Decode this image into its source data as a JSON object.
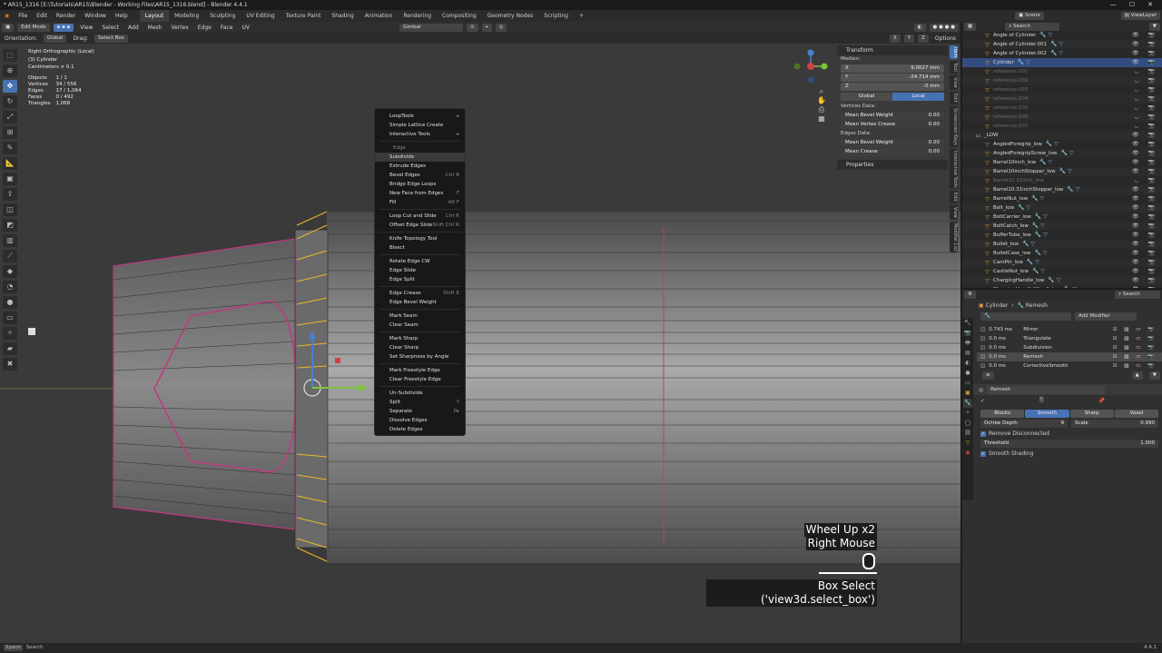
{
  "titlebar": {
    "title": "* AR15_1316 [E:\\Tutorials\\AR15\\Blender - Working Files\\AR15_1316.blend] - Blender 4.4.1"
  },
  "menus": [
    "File",
    "Edit",
    "Render",
    "Window",
    "Help"
  ],
  "workspaces": [
    "Layout",
    "Modeling",
    "Sculpting",
    "UV Editing",
    "Texture Paint",
    "Shading",
    "Animation",
    "Rendering",
    "Compositing",
    "Geometry Nodes",
    "Scripting"
  ],
  "top_right": {
    "scene": "Scene",
    "view_layer": "ViewLayer"
  },
  "viewport_header": {
    "mode": "Edit Mode",
    "menus": [
      "View",
      "Select",
      "Add",
      "Mesh",
      "Vertex",
      "Edge",
      "Face",
      "UV"
    ],
    "transform_orientation": "Gimbal",
    "orientation_label": "Orientation:",
    "orientation_value": "Global",
    "drag_label": "Drag:",
    "drag_value": "Select Box",
    "axes": [
      "X",
      "Y",
      "Z"
    ],
    "options": "Options"
  },
  "stats": {
    "view": "Right Orthographic (Local)",
    "object": "(3) Cylinder",
    "units": "Centimeters × 0.1",
    "rows": [
      {
        "label": "Objects",
        "value": "1 / 1"
      },
      {
        "label": "Vertices",
        "value": "34 / 556"
      },
      {
        "label": "Edges",
        "value": "17 / 1,064"
      },
      {
        "label": "Faces",
        "value": "0 / 492"
      },
      {
        "label": "Triangles",
        "value": "1,068"
      }
    ]
  },
  "context_menu": {
    "items": [
      {
        "label": "LoopTools",
        "shortcut": "▸"
      },
      {
        "label": "Simple Lattice Create",
        "shortcut": ""
      },
      {
        "label": "Interactive Tools",
        "shortcut": "▸"
      },
      {
        "sep": true
      },
      {
        "label": "Edge",
        "shortcut": "",
        "header": true
      },
      {
        "label": "Subdivide",
        "shortcut": "",
        "hl": true
      },
      {
        "label": "Extrude Edges",
        "shortcut": ""
      },
      {
        "label": "Bevel Edges",
        "shortcut": "Ctrl B"
      },
      {
        "label": "Bridge Edge Loops",
        "shortcut": ""
      },
      {
        "label": "New Face from Edges",
        "shortcut": "F"
      },
      {
        "label": "Fill",
        "shortcut": "Alt F"
      },
      {
        "sep": true
      },
      {
        "label": "Loop Cut and Slide",
        "shortcut": "Ctrl R"
      },
      {
        "label": "Offset Edge Slide",
        "shortcut": "Shift Ctrl R"
      },
      {
        "sep": true
      },
      {
        "label": "Knife Topology Tool",
        "shortcut": ""
      },
      {
        "label": "Bisect",
        "shortcut": ""
      },
      {
        "sep": true
      },
      {
        "label": "Rotate Edge CW",
        "shortcut": ""
      },
      {
        "label": "Edge Slide",
        "shortcut": ""
      },
      {
        "label": "Edge Split",
        "shortcut": ""
      },
      {
        "sep": true
      },
      {
        "label": "Edge Crease",
        "shortcut": "Shift E"
      },
      {
        "label": "Edge Bevel Weight",
        "shortcut": ""
      },
      {
        "sep": true
      },
      {
        "label": "Mark Seam",
        "shortcut": ""
      },
      {
        "label": "Clear Seam",
        "shortcut": ""
      },
      {
        "sep": true
      },
      {
        "label": "Mark Sharp",
        "shortcut": ""
      },
      {
        "label": "Clear Sharp",
        "shortcut": ""
      },
      {
        "label": "Set Sharpness by Angle",
        "shortcut": ""
      },
      {
        "sep": true
      },
      {
        "label": "Mark Freestyle Edge",
        "shortcut": ""
      },
      {
        "label": "Clear Freestyle Edge",
        "shortcut": ""
      },
      {
        "sep": true
      },
      {
        "label": "Un-Subdivide",
        "shortcut": ""
      },
      {
        "label": "Split",
        "shortcut": "Y"
      },
      {
        "label": "Separate",
        "shortcut": "P▸"
      },
      {
        "label": "Dissolve Edges",
        "shortcut": ""
      },
      {
        "label": "Delete Edges",
        "shortcut": ""
      }
    ]
  },
  "n_panel": {
    "title": "Transform",
    "median_label": "Median:",
    "x_label": "X",
    "x_value": "9.0027 mm",
    "y_label": "Y",
    "y_value": "-24.714 mm",
    "z_label": "Z",
    "z_value": "-0 mm",
    "global": "Global",
    "local": "Local",
    "vertices_data": "Vertices Data:",
    "mean_bevel_weight": "Mean Bevel Weight",
    "mbw_value": "0.00",
    "mean_vertex_crease": "Mean Vertex Crease",
    "mvc_value": "0.00",
    "edges_data": "Edges Data:",
    "edge_bevel_weight": "Mean Bevel Weight",
    "ebw_value": "0.00",
    "edge_crease": "Mean Crease",
    "ec_value": "0.00",
    "properties": "Properties"
  },
  "side_tabs": [
    "Item",
    "Tool",
    "View",
    "Edit",
    "Screencast Keys",
    "Interactive Tools",
    "Edit",
    "View",
    "Modifier List"
  ],
  "key_overlay": {
    "line1": "Wheel Up x2",
    "line2": "Right Mouse",
    "line3": "Box Select ('view3d.select_box')"
  },
  "statusbar": {
    "left": "Search",
    "version": "4.4.1"
  },
  "outliner": {
    "search_placeholder": "Search",
    "rows": [
      {
        "name": "Angle of Cylinder",
        "dim": false
      },
      {
        "name": "Angle of Cylinder.001",
        "dim": false
      },
      {
        "name": "Angle of Cylinder.002",
        "dim": false
      },
      {
        "name": "Cylinder",
        "dim": false,
        "sel": true
      },
      {
        "name": "reference.001",
        "dim": true
      },
      {
        "name": "reference.002",
        "dim": true
      },
      {
        "name": "reference.003",
        "dim": true
      },
      {
        "name": "reference.004",
        "dim": true
      },
      {
        "name": "reference.005",
        "dim": true
      },
      {
        "name": "reference.006",
        "dim": true
      },
      {
        "name": "reference.007",
        "dim": true
      },
      {
        "name": "_LOW",
        "dim": false,
        "collection": true
      },
      {
        "name": "AngledForegrip_low",
        "dim": false
      },
      {
        "name": "AngledForegripScrew_low",
        "dim": false
      },
      {
        "name": "Barrel10inch_low",
        "dim": false
      },
      {
        "name": "Barrel10inchStopper_low",
        "dim": false
      },
      {
        "name": "Barrel10.31inch_low",
        "dim": true
      },
      {
        "name": "Barrel10.31inchStopper_low",
        "dim": false
      },
      {
        "name": "BarrelNut_low",
        "dim": false
      },
      {
        "name": "Bolt_low",
        "dim": false
      },
      {
        "name": "BoltCarrier_low",
        "dim": false
      },
      {
        "name": "BoltCatch_low",
        "dim": false
      },
      {
        "name": "BufferTube_low",
        "dim": false
      },
      {
        "name": "Bullet_low",
        "dim": false
      },
      {
        "name": "BulletCase_low",
        "dim": false
      },
      {
        "name": "CamPin_low",
        "dim": false
      },
      {
        "name": "CastleNut_low",
        "dim": false
      },
      {
        "name": "ChargingHandle_low",
        "dim": false
      },
      {
        "name": "ChargingHandleWingA_low",
        "dim": false
      }
    ]
  },
  "properties": {
    "object": "Cylinder",
    "modifier": "Remesh",
    "add_modifier": "Add Modifier",
    "modifiers": [
      {
        "time": "0.743 ms",
        "name": "Mirror"
      },
      {
        "time": "0.0 ms",
        "name": "Triangulate"
      },
      {
        "time": "0.0 ms",
        "name": "Subdivision"
      },
      {
        "time": "0.0 ms",
        "name": "Remesh",
        "sel": true
      },
      {
        "time": "0.0 ms",
        "name": "CorrectiveSmooth"
      }
    ],
    "remesh_name": "Remesh",
    "modes": [
      "Blocks",
      "Smooth",
      "Sharp",
      "Voxel"
    ],
    "octree_label": "Octree Depth",
    "octree_value": "9",
    "scale_label": "Scale",
    "scale_value": "0.990",
    "remove_disconnected": "Remove Disconnected",
    "threshold_label": "Threshold",
    "threshold_value": "1.000",
    "smooth_shading": "Smooth Shading"
  }
}
